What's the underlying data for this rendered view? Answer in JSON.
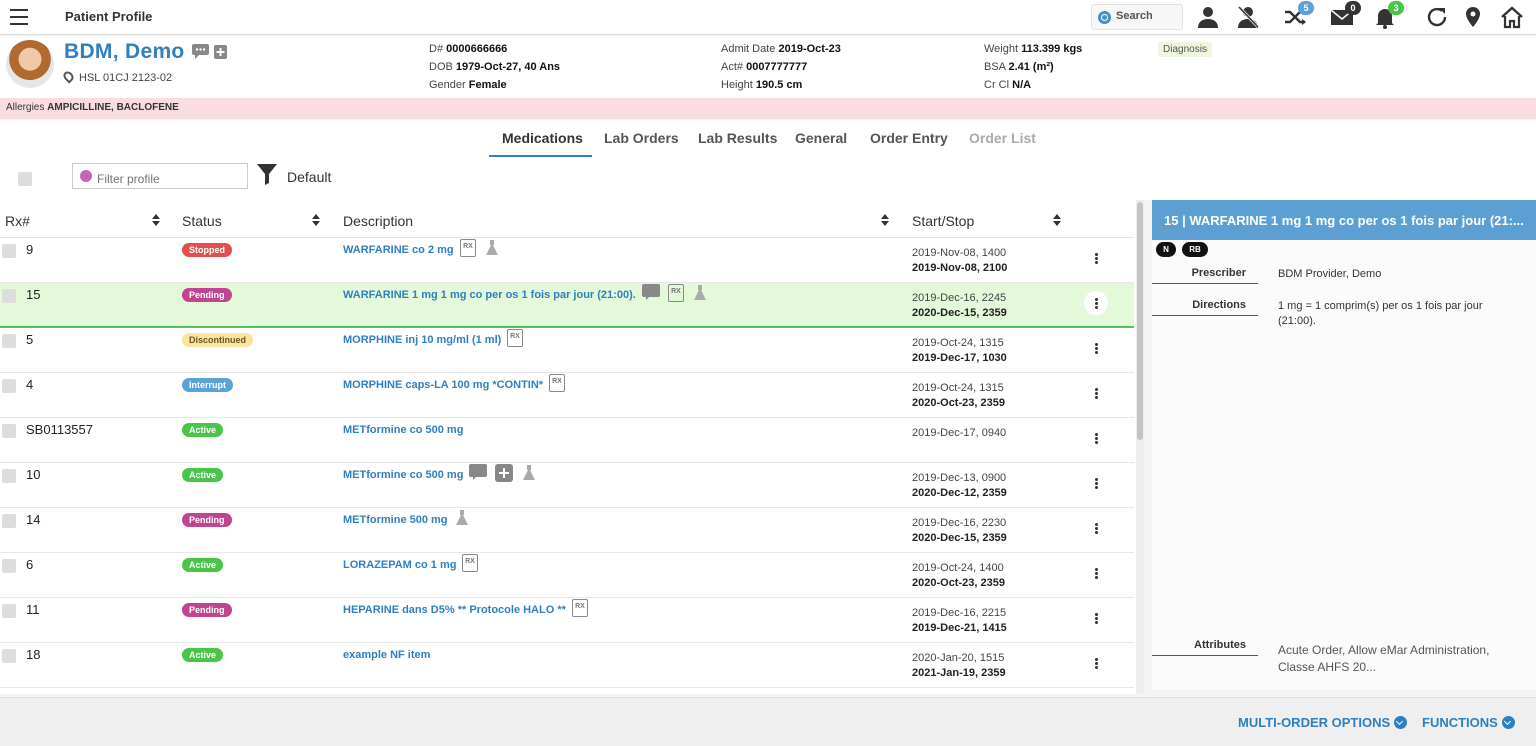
{
  "app": {
    "title": "Patient Profile",
    "search_label": "Search"
  },
  "topbar": {
    "icons": [
      {
        "name": "user-icon"
      },
      {
        "name": "user-off-icon"
      },
      {
        "name": "shuffle-icon",
        "badge": "5",
        "badge_color": "#5ba3d6"
      },
      {
        "name": "mail-icon",
        "badge": "0",
        "badge_color": "#333333"
      },
      {
        "name": "bell-icon",
        "badge": "3",
        "badge_color": "#4bc44a"
      },
      {
        "name": "refresh-icon"
      },
      {
        "name": "location-icon"
      },
      {
        "name": "home-icon"
      }
    ]
  },
  "patient": {
    "name": "BDM, Demo",
    "location": "HSL 01CJ 2123-02",
    "d_label": "D#",
    "d_value": "0000666666",
    "dob_label": "DOB",
    "dob_value": "1979-Oct-27, 40 Ans",
    "gender_label": "Gender",
    "gender_value": "Female",
    "admit_label": "Admit Date",
    "admit_value": "2019-Oct-23",
    "act_label": "Act#",
    "act_value": "0007777777",
    "height_label": "Height",
    "height_value": "190.5 cm",
    "weight_label": "Weight",
    "weight_value": "113.399 kgs",
    "bsa_label": "BSA",
    "bsa_value": "2.41 (m²)",
    "crcl_label": "Cr Cl",
    "crcl_value": "N/A",
    "diagnosis_label": "Diagnosis",
    "allergies_label": "Allergies",
    "allergies_value": "AMPICILLINE, BACLOFENE"
  },
  "tabs": [
    {
      "label": "Medications",
      "state": "active"
    },
    {
      "label": "Lab Orders",
      "state": "normal"
    },
    {
      "label": "Lab Results",
      "state": "normal"
    },
    {
      "label": "General",
      "state": "normal"
    },
    {
      "label": "Order Entry",
      "state": "normal"
    },
    {
      "label": "Order List",
      "state": "disabled"
    }
  ],
  "filter": {
    "placeholder": "Filter profile",
    "default_label": "Default"
  },
  "grid": {
    "headers": {
      "rx": "Rx#",
      "status": "Status",
      "description": "Description",
      "startstop": "Start/Stop"
    },
    "rows": [
      {
        "rx": "9",
        "status": "Stopped",
        "desc": "WARFARINE co 2 mg",
        "icons": [
          "rx",
          "flask"
        ],
        "start": "2019-Nov-08, 1400",
        "stop": "2019-Nov-08, 2100"
      },
      {
        "rx": "15",
        "status": "Pending",
        "desc": "WARFARINE 1 mg 1 mg co per os 1 fois par jour (21:00).",
        "icons": [
          "chat",
          "rx",
          "flask"
        ],
        "start": "2019-Dec-16, 2245",
        "stop": "2020-Dec-15, 2359",
        "selected": true
      },
      {
        "rx": "5",
        "status": "Discontinued",
        "desc": "MORPHINE inj 10 mg/ml (1 ml)",
        "icons": [
          "rx"
        ],
        "start": "2019-Oct-24, 1315",
        "stop": "2019-Dec-17, 1030"
      },
      {
        "rx": "4",
        "status": "Interrupt",
        "desc": "MORPHINE caps-LA 100 mg *CONTIN*",
        "icons": [
          "rx"
        ],
        "start": "2019-Oct-24, 1315",
        "stop": "2020-Oct-23, 2359"
      },
      {
        "rx": "SB0113557",
        "status": "Active",
        "desc": "METformine co 500 mg",
        "icons": [],
        "start": "2019-Dec-17, 0940",
        "stop": ""
      },
      {
        "rx": "10",
        "status": "Active",
        "desc": "METformine co 500 mg",
        "icons": [
          "chat",
          "plus",
          "flask"
        ],
        "start": "2019-Dec-13, 0900",
        "stop": "2020-Dec-12, 2359"
      },
      {
        "rx": "14",
        "status": "Pending",
        "desc": "METformine 500 mg",
        "icons": [
          "flask"
        ],
        "start": "2019-Dec-16, 2230",
        "stop": "2020-Dec-15, 2359"
      },
      {
        "rx": "6",
        "status": "Active",
        "desc": "LORAZEPAM co 1 mg",
        "icons": [
          "rx"
        ],
        "start": "2019-Oct-24, 1400",
        "stop": "2020-Oct-23, 2359"
      },
      {
        "rx": "11",
        "status": "Pending",
        "desc": "HEPARINE dans D5% ** Protocole HALO **",
        "icons": [
          "rx"
        ],
        "start": "2019-Dec-16, 2215",
        "stop": "2019-Dec-21, 1415"
      },
      {
        "rx": "18",
        "status": "Active",
        "desc": "example NF item",
        "icons": [],
        "start": "2020-Jan-20, 1515",
        "stop": "2021-Jan-19, 2359"
      }
    ]
  },
  "detail": {
    "title": "15 | WARFARINE 1 mg 1 mg co per os 1 fois par jour (21:...",
    "pills": [
      "N",
      "RB"
    ],
    "prescriber_label": "Prescriber",
    "prescriber_value": "BDM Provider, Demo",
    "directions_label": "Directions",
    "directions_value": "1 mg = 1 comprim(s) per os 1 fois par jour (21:00).",
    "attributes_label": "Attributes",
    "attributes_value": "Acute Order, Allow eMar Administration, Classe AHFS 20..."
  },
  "footer": {
    "multi_order": "MULTI-ORDER OPTIONS",
    "functions": "FUNCTIONS"
  }
}
